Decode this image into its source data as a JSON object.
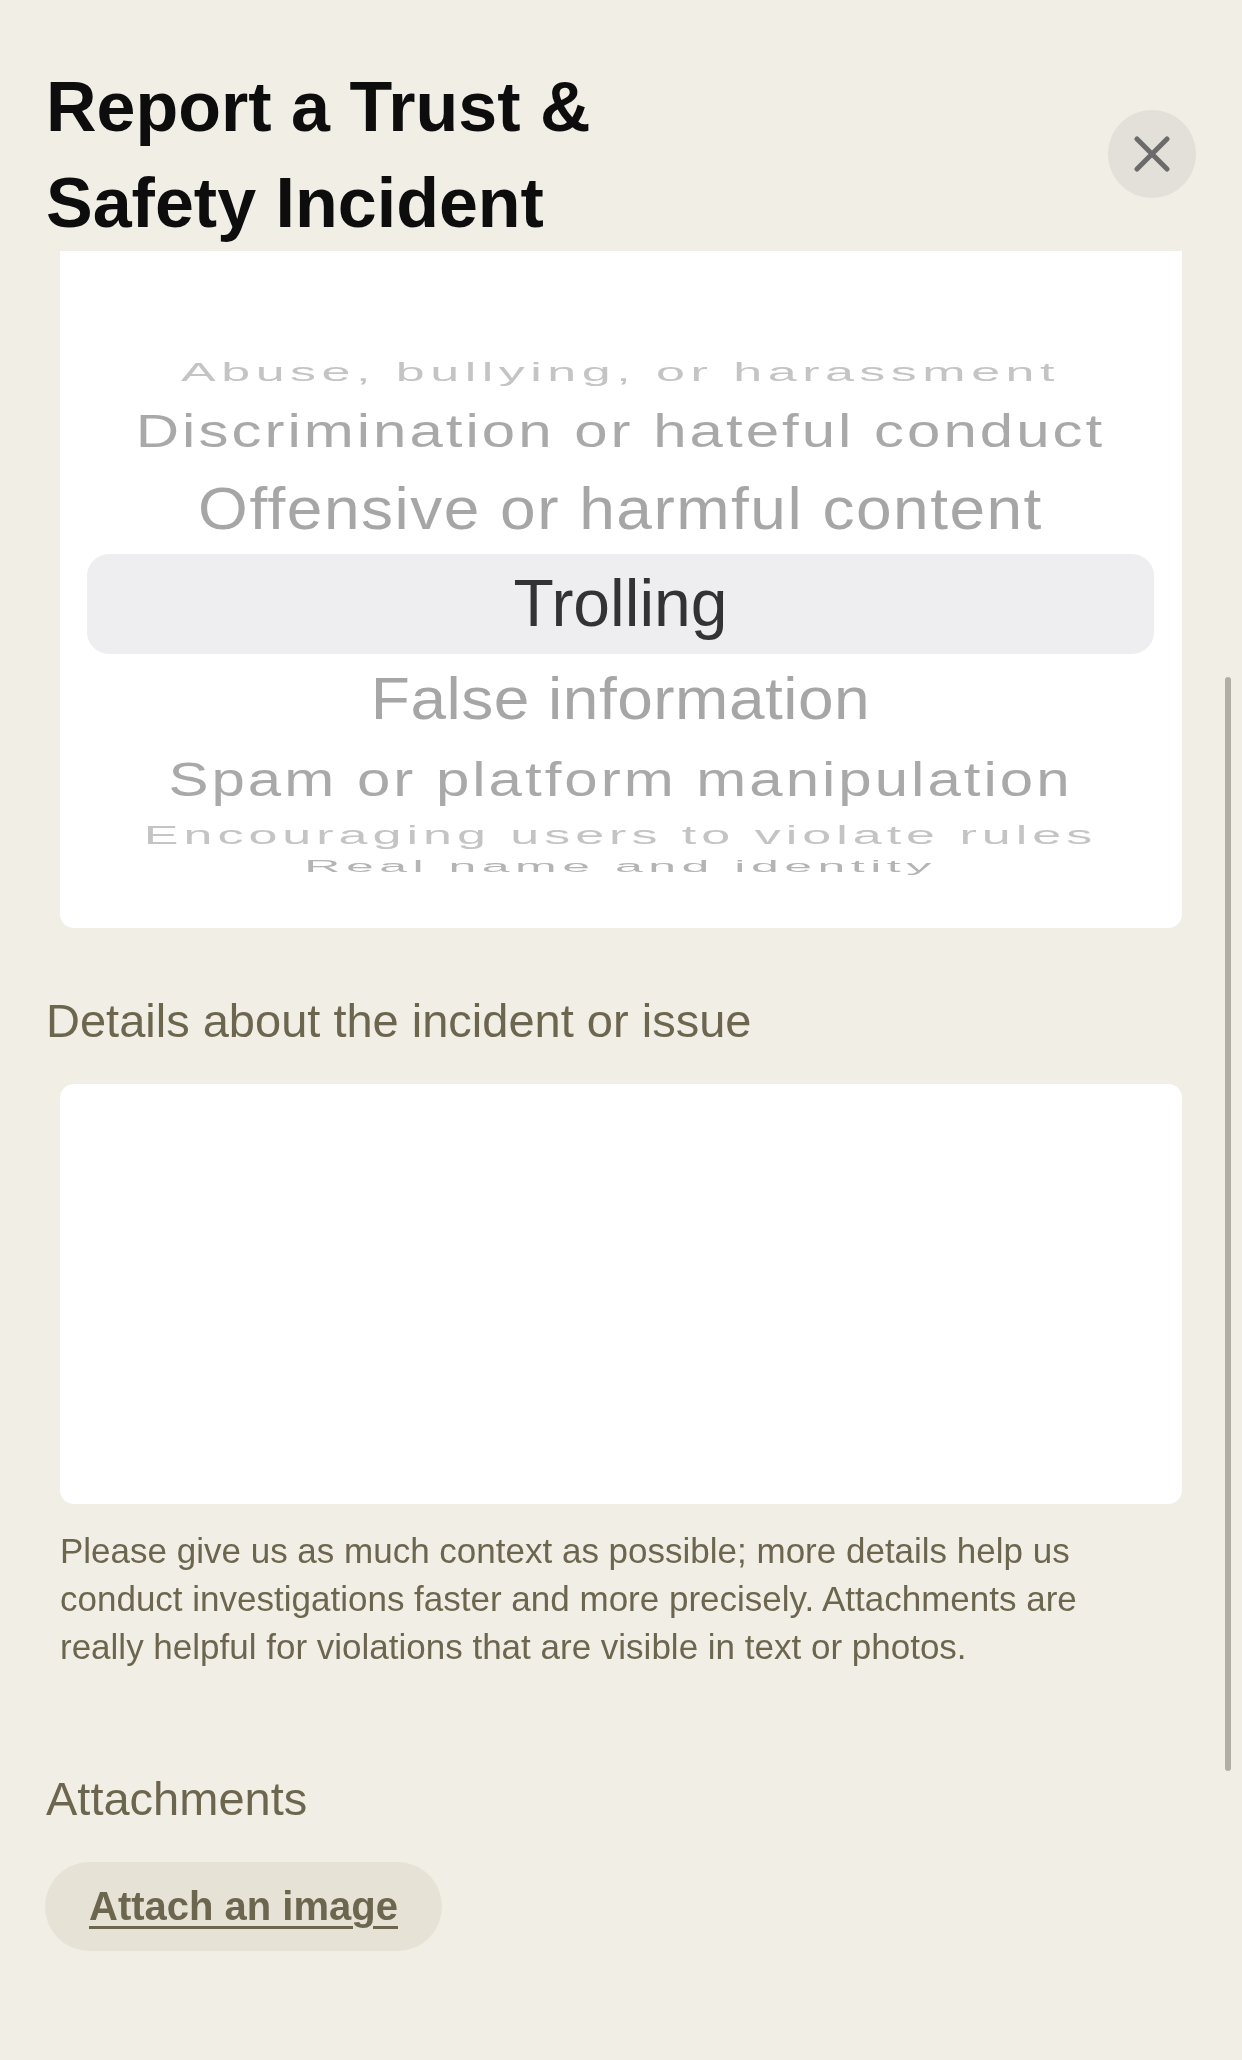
{
  "dialog": {
    "title": "Report a Trust & Safety Incident"
  },
  "picker": {
    "options": [
      {
        "label": "Abuse, bullying, or harassment",
        "selected": false
      },
      {
        "label": "Discrimination or hateful conduct",
        "selected": false
      },
      {
        "label": "Offensive or harmful content",
        "selected": false
      },
      {
        "label": "Trolling",
        "selected": true
      },
      {
        "label": "False information",
        "selected": false
      },
      {
        "label": "Spam or platform manipulation",
        "selected": false
      },
      {
        "label": "Encouraging users to violate rules",
        "selected": false
      },
      {
        "label": "Real name and identity",
        "selected": false
      }
    ]
  },
  "details": {
    "label": "Details about the incident or issue",
    "help": "Please give us as much context as possible; more details help us conduct investigations faster and more precisely. Attachments are really helpful for violations that are visible in text or photos."
  },
  "attachments": {
    "label": "Attachments",
    "button": "Attach an image"
  }
}
